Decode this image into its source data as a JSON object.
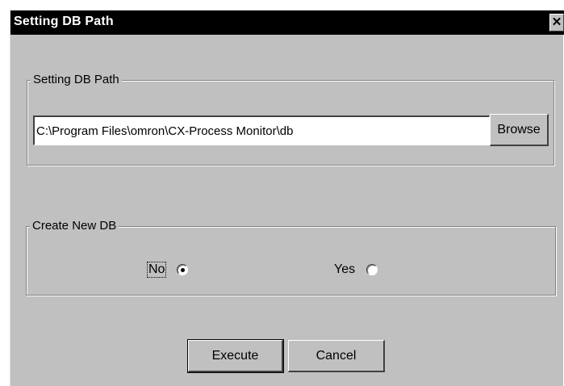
{
  "window": {
    "title": "Setting DB Path",
    "close_label": "✕"
  },
  "path_group": {
    "label": "Setting DB Path",
    "path_value": "C:\\Program Files\\omron\\CX-Process Monitor\\db",
    "browse_label": "Browse"
  },
  "create_group": {
    "label": "Create New DB",
    "options": [
      {
        "label": "No",
        "selected": true
      },
      {
        "label": "Yes",
        "selected": false
      }
    ]
  },
  "actions": {
    "execute_label": "Execute",
    "cancel_label": "Cancel"
  }
}
